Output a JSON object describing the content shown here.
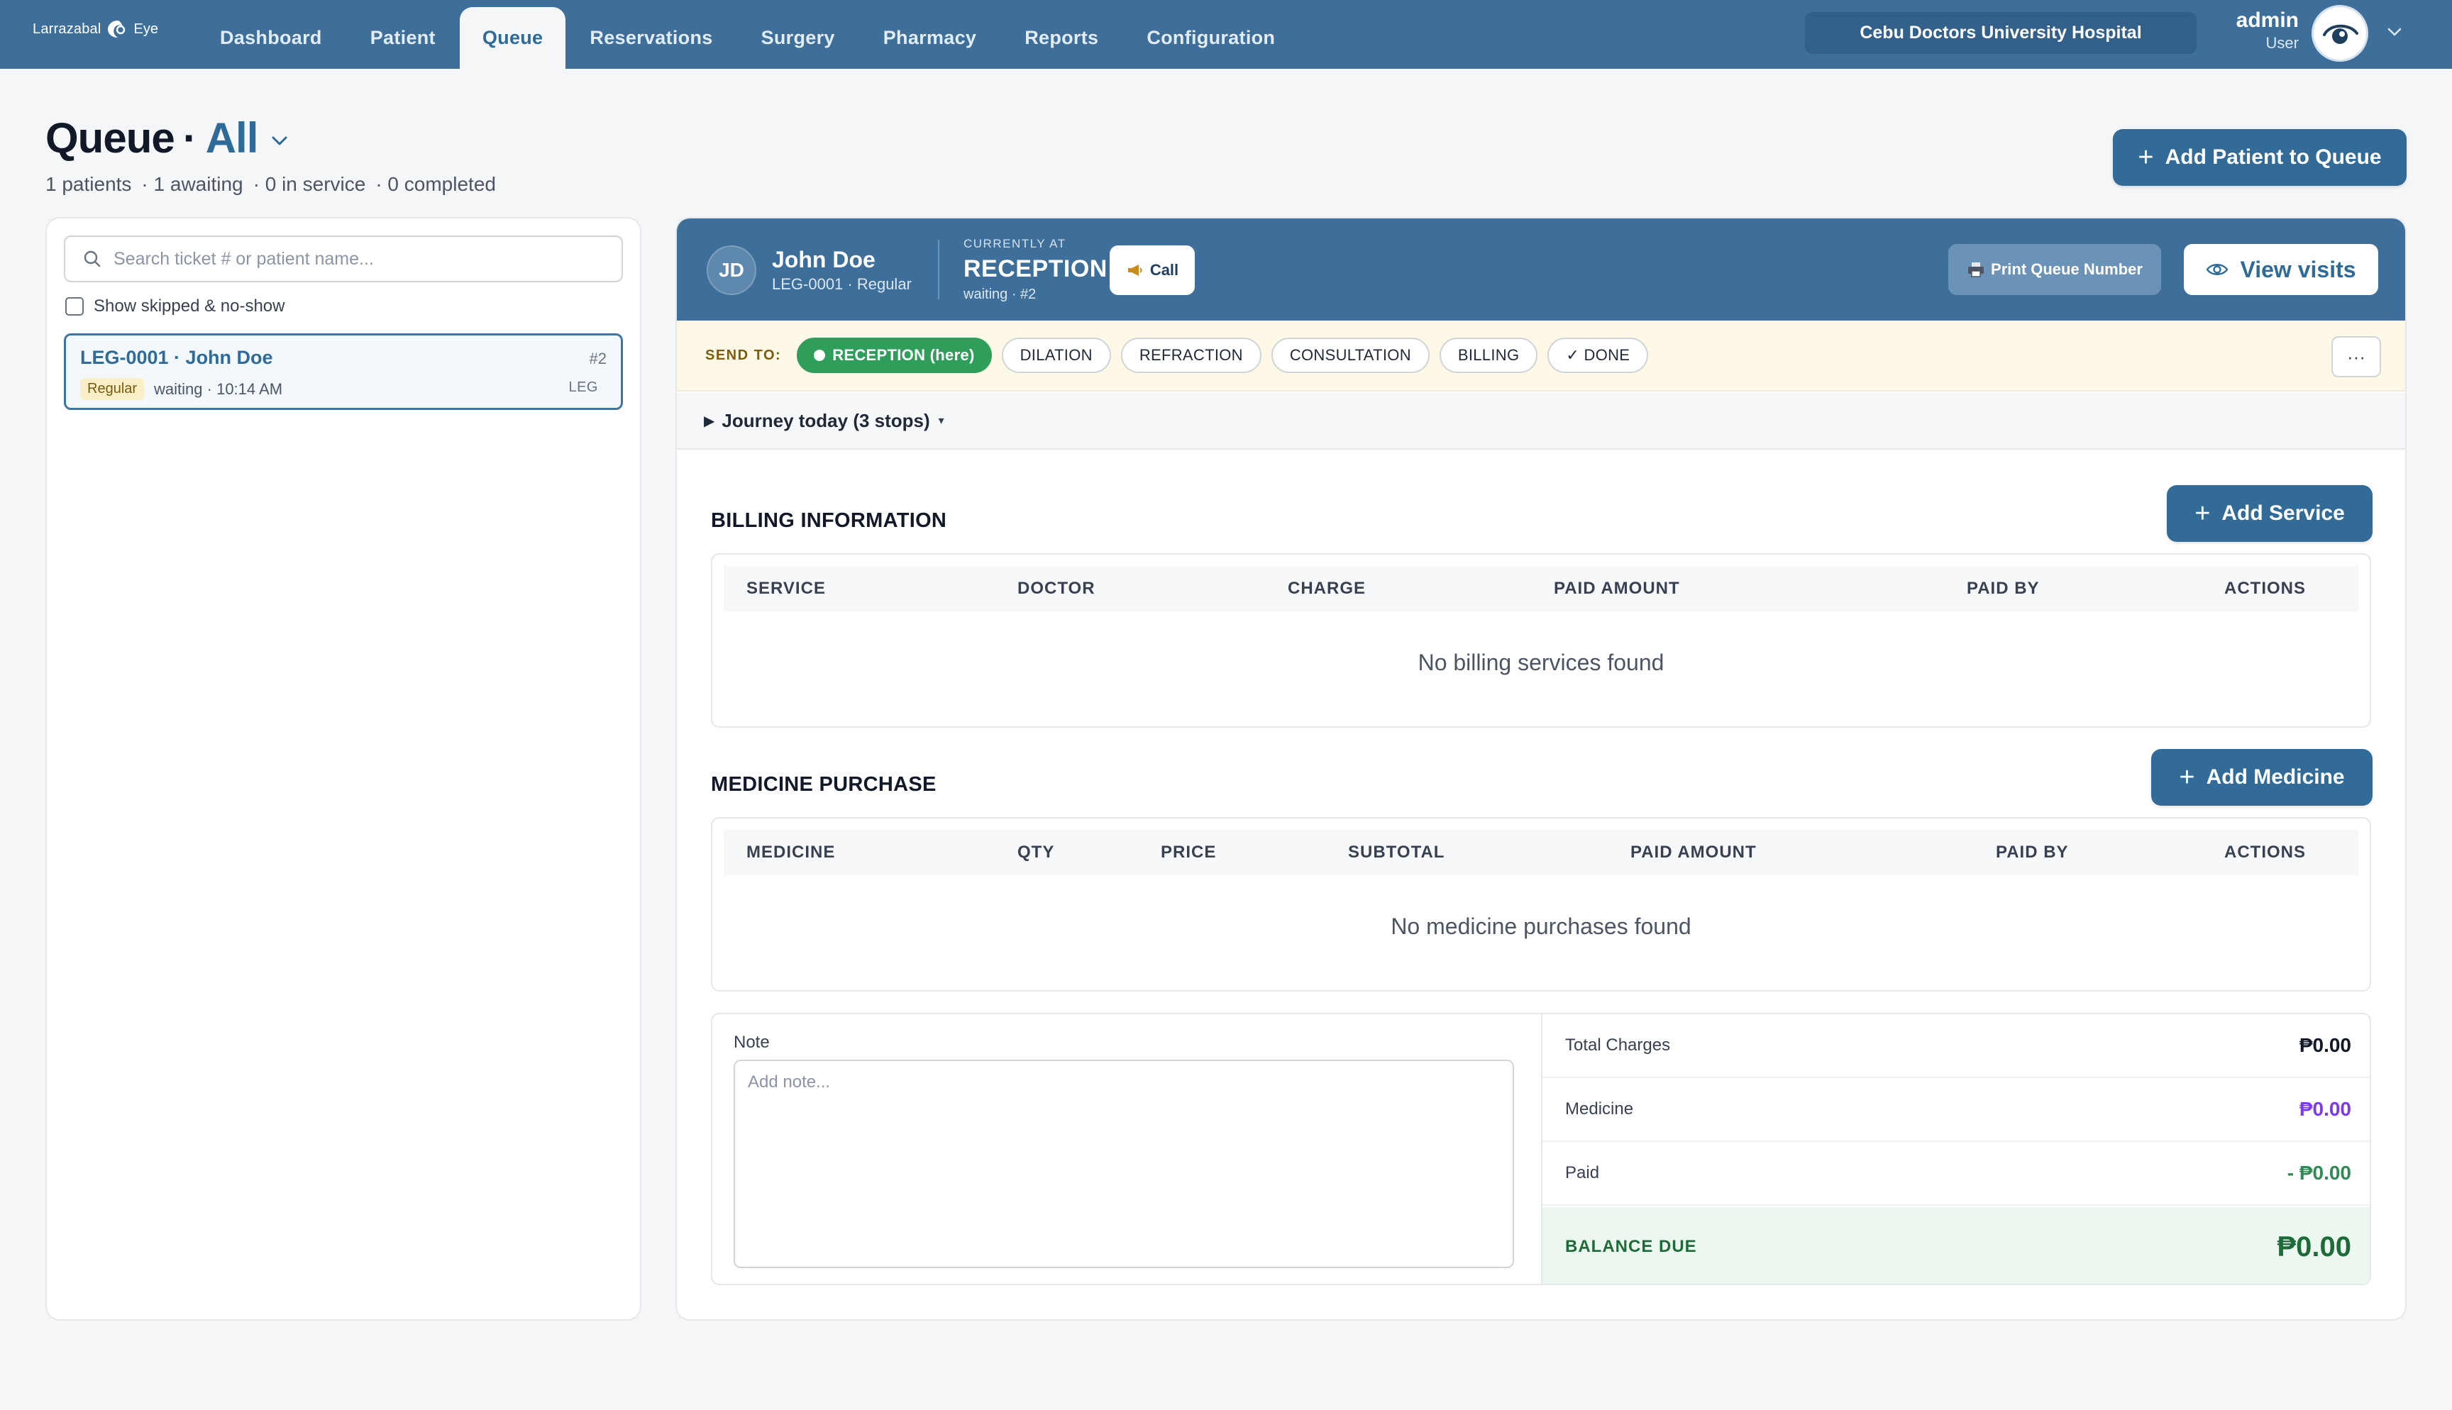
{
  "brand": {
    "left": "Larrazabal",
    "right": "Eye"
  },
  "nav": {
    "items": [
      {
        "label": "Dashboard"
      },
      {
        "label": "Patient"
      },
      {
        "label": "Queue"
      },
      {
        "label": "Reservations"
      },
      {
        "label": "Surgery"
      },
      {
        "label": "Pharmacy"
      },
      {
        "label": "Reports"
      },
      {
        "label": "Configuration"
      }
    ],
    "active": "Queue"
  },
  "hospital": "Cebu Doctors University Hospital",
  "user": {
    "name": "admin",
    "role": "User"
  },
  "page": {
    "title": "Queue",
    "separator": "·",
    "filter": "All",
    "stats": [
      "1 patients",
      "· 1 awaiting",
      "· 0 in service",
      "· 0 completed"
    ],
    "add_button": "Add Patient to Queue"
  },
  "left": {
    "search_placeholder": "Search ticket # or patient name...",
    "show_skipped_label": "Show skipped & no-show",
    "queue_items": [
      {
        "title": "LEG-0001 · John Doe",
        "number": "#2",
        "badge": "Regular",
        "meta": "waiting · 10:14 AM",
        "code": "LEG"
      }
    ]
  },
  "patient": {
    "initials": "JD",
    "name": "John Doe",
    "sub": "LEG-0001 · Regular",
    "currently_label": "CURRENTLY AT",
    "station": "RECEPTION",
    "status": "waiting · #2",
    "call_label": "Call",
    "print_label": "Print Queue Number",
    "view_visits_label": "View visits"
  },
  "send_to": {
    "label": "SEND TO:",
    "current": "RECEPTION (here)",
    "options": [
      "DILATION",
      "REFRACTION",
      "CONSULTATION",
      "BILLING",
      "✓ DONE"
    ],
    "more": "···"
  },
  "journey": {
    "label": "Journey today (3 stops)"
  },
  "billing": {
    "title": "BILLING INFORMATION",
    "add_button": "Add Service",
    "columns": [
      "SERVICE",
      "DOCTOR",
      "CHARGE",
      "PAID AMOUNT",
      "PAID BY",
      "ACTIONS"
    ],
    "empty": "No billing services found"
  },
  "medicine": {
    "title": "MEDICINE PURCHASE",
    "add_button": "Add Medicine",
    "columns": [
      "MEDICINE",
      "QTY",
      "PRICE",
      "SUBTOTAL",
      "PAID AMOUNT",
      "PAID BY",
      "ACTIONS"
    ],
    "empty": "No medicine purchases found"
  },
  "summary": {
    "note_label": "Note",
    "note_placeholder": "Add note...",
    "total_charges_label": "Total Charges",
    "total_charges": "₱0.00",
    "medicine_label": "Medicine",
    "medicine": "₱0.00",
    "paid_label": "Paid",
    "paid": "- ₱0.00",
    "balance_label": "BALANCE DUE",
    "balance": "₱0.00"
  },
  "colors": {
    "primary": "#3d6f9a",
    "accent_blue": "#2f6b98",
    "success": "#2f9e5b",
    "medicine_purple": "#7c3aed",
    "paid_green": "#2f8a55",
    "balance_green": "#1e6b3a",
    "send_bar": "#fdf9e6"
  }
}
